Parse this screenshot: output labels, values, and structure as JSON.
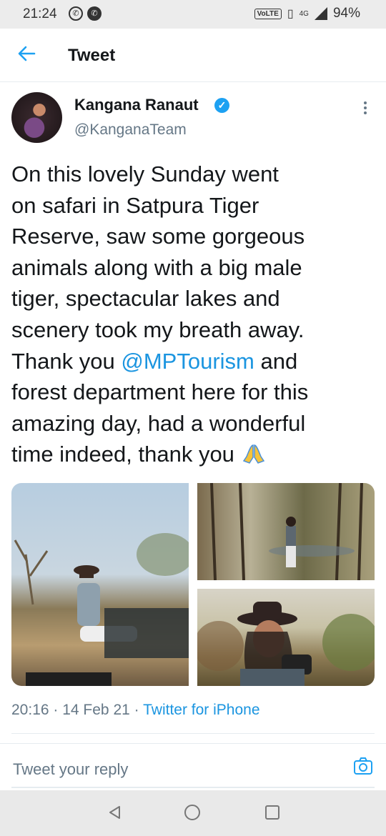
{
  "status_bar": {
    "time": "21:24",
    "network_badge": "VoLTE",
    "network_type": "4G",
    "battery": "94%",
    "icons": [
      "whatsapp-icon",
      "phone-icon",
      "vibrate-icon",
      "signal-icon"
    ]
  },
  "app_bar": {
    "title": "Tweet",
    "back_icon": "arrow-left-icon"
  },
  "tweet": {
    "author_name": "Kangana Ranaut",
    "author_handle": "@KanganaTeam",
    "verified": true,
    "text_before_mention": "On this lovely Sunday went\non safari in Satpura Tiger\nReserve, saw some gorgeous\nanimals along with a big male\ntiger, spectacular lakes and\nscenery took my breath away.\nThank you ",
    "mention": "@MPTourism",
    "text_after_mention": " and\nforest department here for this\namazing day, had a wonderful\ntime indeed, thank you ",
    "emoji": "folded-hands-emoji",
    "media_count": 3,
    "time": "20:16",
    "date": "14 Feb 21",
    "source": "Twitter for iPhone",
    "separator": " · "
  },
  "reply": {
    "placeholder": "Tweet your reply",
    "camera_icon": "camera-icon"
  },
  "nav_bar": {
    "icons": [
      "back-triangle-icon",
      "home-circle-icon",
      "recents-square-icon"
    ]
  },
  "colors": {
    "accent": "#1da1f2",
    "link": "#1b95e0",
    "secondary_text": "#657786",
    "primary_text": "#14171a"
  }
}
